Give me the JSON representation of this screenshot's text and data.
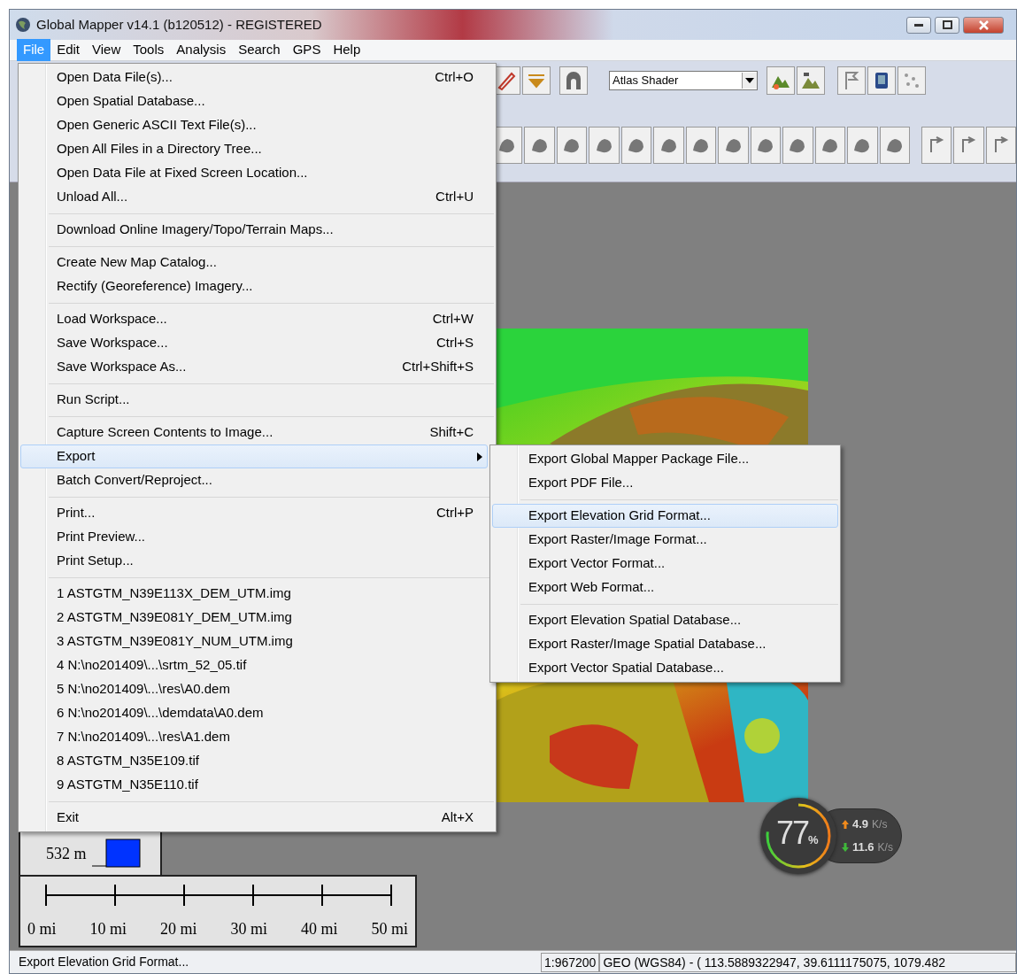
{
  "window": {
    "title": "Global Mapper v14.1 (b120512) - REGISTERED"
  },
  "menubar": [
    {
      "label": "File",
      "selected": true
    },
    {
      "label": "Edit",
      "selected": false
    },
    {
      "label": "View",
      "selected": false
    },
    {
      "label": "Tools",
      "selected": false
    },
    {
      "label": "Analysis",
      "selected": false
    },
    {
      "label": "Search",
      "selected": false
    },
    {
      "label": "GPS",
      "selected": false
    },
    {
      "label": "Help",
      "selected": false
    }
  ],
  "toolbar": {
    "shader": "Atlas Shader"
  },
  "file_menu": {
    "groups": [
      [
        {
          "label": "Open Data File(s)...",
          "shortcut": "Ctrl+O",
          "selected": false
        },
        {
          "label": "Open Spatial Database...",
          "selected": false
        },
        {
          "label": "Open Generic ASCII Text File(s)...",
          "selected": false
        },
        {
          "label": "Open All Files in a Directory Tree...",
          "selected": false
        },
        {
          "label": "Open Data File at Fixed Screen Location...",
          "selected": false
        },
        {
          "label": "Unload All...",
          "shortcut": "Ctrl+U",
          "selected": false
        }
      ],
      [
        {
          "label": "Download Online Imagery/Topo/Terrain Maps...",
          "selected": false
        }
      ],
      [
        {
          "label": "Create New Map Catalog...",
          "selected": false
        },
        {
          "label": "Rectify (Georeference) Imagery...",
          "selected": false
        }
      ],
      [
        {
          "label": "Load Workspace...",
          "shortcut": "Ctrl+W",
          "selected": false
        },
        {
          "label": "Save Workspace...",
          "shortcut": "Ctrl+S",
          "selected": false
        },
        {
          "label": "Save Workspace As...",
          "shortcut": "Ctrl+Shift+S",
          "selected": false
        }
      ],
      [
        {
          "label": "Run Script...",
          "selected": false
        }
      ],
      [
        {
          "label": "Capture Screen Contents to Image...",
          "shortcut": "Shift+C",
          "selected": false
        },
        {
          "label": "Export",
          "has_submenu": true,
          "selected": true
        },
        {
          "label": "Batch Convert/Reproject...",
          "selected": false
        }
      ],
      [
        {
          "label": "Print...",
          "shortcut": "Ctrl+P",
          "selected": false
        },
        {
          "label": "Print Preview...",
          "selected": false
        },
        {
          "label": "Print Setup...",
          "selected": false
        }
      ],
      [
        {
          "label": "1 ASTGTM_N39E113X_DEM_UTM.img",
          "selected": false
        },
        {
          "label": "2 ASTGTM_N39E081Y_DEM_UTM.img",
          "selected": false
        },
        {
          "label": "3 ASTGTM_N39E081Y_NUM_UTM.img",
          "selected": false
        },
        {
          "label": "4 N:\\no201409\\...\\srtm_52_05.tif",
          "selected": false
        },
        {
          "label": "5 N:\\no201409\\...\\res\\A0.dem",
          "selected": false
        },
        {
          "label": "6 N:\\no201409\\...\\demdata\\A0.dem",
          "selected": false
        },
        {
          "label": "7 N:\\no201409\\...\\res\\A1.dem",
          "selected": false
        },
        {
          "label": "8 ASTGTM_N35E109.tif",
          "selected": false
        },
        {
          "label": "9 ASTGTM_N35E110.tif",
          "selected": false
        }
      ],
      [
        {
          "label": "Exit",
          "shortcut": "Alt+X",
          "selected": false
        }
      ]
    ]
  },
  "export_menu": {
    "groups": [
      [
        {
          "label": "Export Global Mapper Package File...",
          "selected": false
        },
        {
          "label": "Export PDF File...",
          "selected": false
        }
      ],
      [
        {
          "label": "Export Elevation Grid Format...",
          "selected": true
        },
        {
          "label": "Export Raster/Image Format...",
          "selected": false
        },
        {
          "label": "Export Vector Format...",
          "selected": false
        },
        {
          "label": "Export Web Format...",
          "selected": false
        }
      ],
      [
        {
          "label": "Export Elevation Spatial Database...",
          "selected": false
        },
        {
          "label": "Export Raster/Image Spatial Database...",
          "selected": false
        },
        {
          "label": "Export Vector Spatial Database...",
          "selected": false
        }
      ]
    ]
  },
  "legend": {
    "elevation": "532 m"
  },
  "scale_bar": {
    "labels": [
      "0 mi",
      "10 mi",
      "20 mi",
      "30 mi",
      "40 mi",
      "50 mi"
    ]
  },
  "speed_widget": {
    "percent": "77",
    "percent_unit": "%",
    "upload": "4.9",
    "upload_unit": "K/s",
    "download": "11.6",
    "download_unit": "K/s"
  },
  "status_bar": {
    "message": "Export Elevation Grid Format...",
    "scale": "1:967200",
    "position": "GEO (WGS84) - ( 113.5889322947, 39.6111175075, 1079.482"
  }
}
